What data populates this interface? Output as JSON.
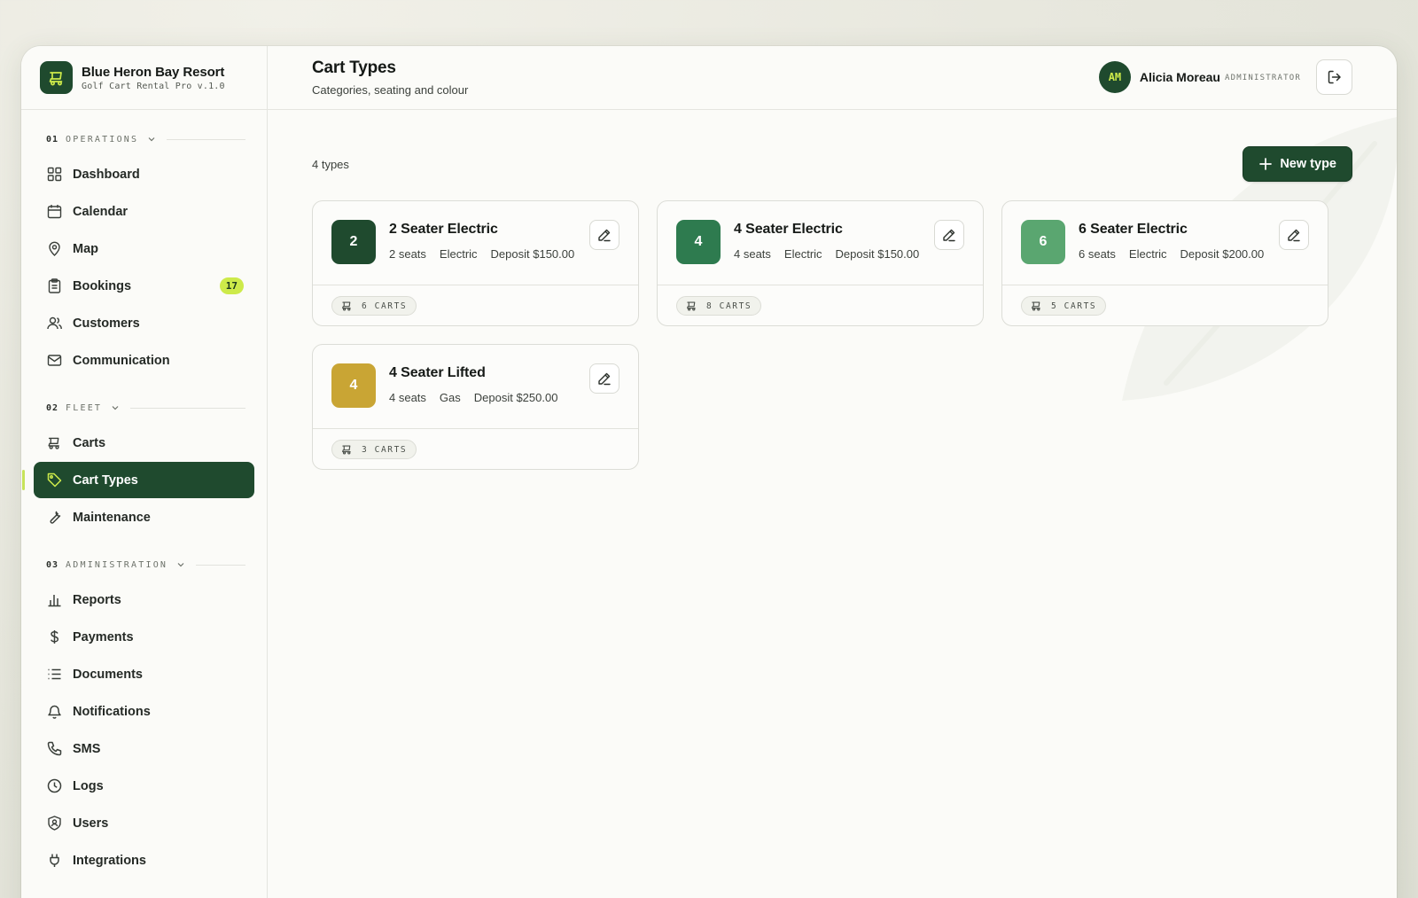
{
  "brand": {
    "name": "Blue Heron Bay Resort",
    "subtitle": "Golf Cart Rental Pro v.1.0"
  },
  "sidebar": {
    "sections": [
      {
        "num": "01",
        "label": "OPERATIONS",
        "items": [
          {
            "label": "Dashboard",
            "icon": "dashboard-icon"
          },
          {
            "label": "Calendar",
            "icon": "calendar-icon"
          },
          {
            "label": "Map",
            "icon": "map-pin-icon"
          },
          {
            "label": "Bookings",
            "icon": "clipboard-icon",
            "badge": "17"
          },
          {
            "label": "Customers",
            "icon": "users-icon"
          },
          {
            "label": "Communication",
            "icon": "mail-icon"
          }
        ]
      },
      {
        "num": "02",
        "label": "FLEET",
        "items": [
          {
            "label": "Carts",
            "icon": "cart-icon"
          },
          {
            "label": "Cart Types",
            "icon": "tag-icon",
            "active": true
          },
          {
            "label": "Maintenance",
            "icon": "wrench-icon"
          }
        ]
      },
      {
        "num": "03",
        "label": "ADMINISTRATION",
        "items": [
          {
            "label": "Reports",
            "icon": "bar-chart-icon"
          },
          {
            "label": "Payments",
            "icon": "dollar-icon"
          },
          {
            "label": "Documents",
            "icon": "list-icon"
          },
          {
            "label": "Notifications",
            "icon": "bell-icon"
          },
          {
            "label": "SMS",
            "icon": "phone-icon"
          },
          {
            "label": "Logs",
            "icon": "clock-icon"
          },
          {
            "label": "Users",
            "icon": "shield-user-icon"
          },
          {
            "label": "Integrations",
            "icon": "plug-icon"
          }
        ]
      }
    ]
  },
  "header": {
    "title": "Cart Types",
    "subtitle": "Categories, seating and colour",
    "user": {
      "initials": "AM",
      "name": "Alicia Moreau",
      "role": "ADMINISTRATOR"
    }
  },
  "main": {
    "count_label": "4 types",
    "new_button_label": "New type",
    "cards": [
      {
        "number": "2",
        "name": "2 Seater Electric",
        "seats": "2 seats",
        "fuel": "Electric",
        "deposit": "Deposit $150.00",
        "carts": "6 CARTS",
        "color": "#1f4a2e"
      },
      {
        "number": "4",
        "name": "4 Seater Electric",
        "seats": "4 seats",
        "fuel": "Electric",
        "deposit": "Deposit $150.00",
        "carts": "8 CARTS",
        "color": "#2e7b4f"
      },
      {
        "number": "6",
        "name": "6 Seater Electric",
        "seats": "6 seats",
        "fuel": "Electric",
        "deposit": "Deposit $200.00",
        "carts": "5 CARTS",
        "color": "#5aa670"
      },
      {
        "number": "4",
        "name": "4 Seater Lifted",
        "seats": "4 seats",
        "fuel": "Gas",
        "deposit": "Deposit $250.00",
        "carts": "3 CARTS",
        "color": "#c9a534"
      }
    ]
  },
  "colors": {
    "brand_green": "#1f4a2e",
    "accent_lime": "#cdea4a"
  }
}
